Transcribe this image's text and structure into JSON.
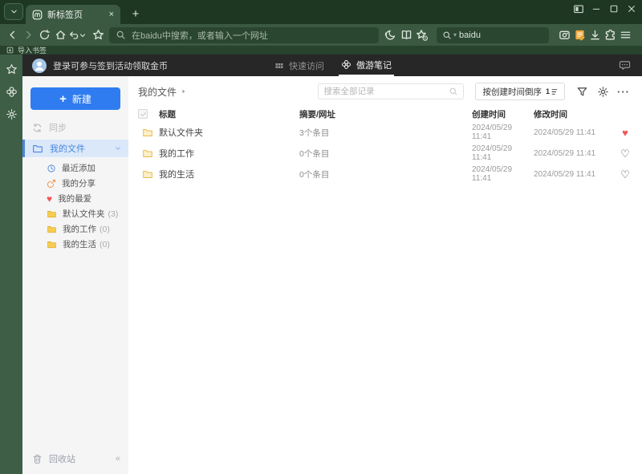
{
  "browser": {
    "tab_title": "新标签页",
    "address_placeholder": "在baidu中搜索，或者输入一个网址",
    "search_value": "baidu",
    "import_bookmarks": "导入书签"
  },
  "app_header": {
    "login_text": "登录可参与签到活动领取金币",
    "tabs": [
      {
        "label": "快速访问",
        "active": false
      },
      {
        "label": "傲游笔记",
        "active": true
      }
    ]
  },
  "notes_sidebar": {
    "new_button": "新建",
    "sync": "同步",
    "my_files": "我的文件",
    "items": [
      {
        "label": "最近添加"
      },
      {
        "label": "我的分享"
      },
      {
        "label": "我的最爱"
      },
      {
        "label": "默认文件夹",
        "count": "(3)"
      },
      {
        "label": "我的工作",
        "count": "(0)"
      },
      {
        "label": "我的生活",
        "count": "(0)"
      }
    ],
    "recycle_bin": "回收站"
  },
  "main": {
    "breadcrumb": "我的文件",
    "search_placeholder": "搜索全部记录",
    "sort_button": "按创建时间倒序",
    "table": {
      "headers": {
        "title": "标题",
        "summary": "摘要/网址",
        "created": "创建时间",
        "modified": "修改时间"
      },
      "rows": [
        {
          "title": "默认文件夹",
          "summary": "3个条目",
          "created": "2024/05/29 11:41",
          "modified": "2024/05/29 11:41",
          "favorite": true
        },
        {
          "title": "我的工作",
          "summary": "0个条目",
          "created": "2024/05/29 11:41",
          "modified": "2024/05/29 11:41",
          "favorite": false
        },
        {
          "title": "我的生活",
          "summary": "0个条目",
          "created": "2024/05/29 11:41",
          "modified": "2024/05/29 11:41",
          "favorite": false
        }
      ]
    }
  },
  "icons": {
    "plus": "+",
    "new_tab_plus": "+",
    "close_x": "×",
    "heart_filled": "♥",
    "heart_outline": "♡",
    "more_dots": "···",
    "collapse": "«",
    "sort_numeral": "1",
    "search_caret": "▾"
  },
  "colors": {
    "tab_bar_bg": "#1d3723",
    "toolbar_bg": "#3b5941",
    "address_bar_bg": "#2a4631",
    "app_header_bg": "#272727",
    "sidebar_bg": "#f5f5f6",
    "accent_blue": "#2f7cf0",
    "selected_item_bg": "#dbe8fa",
    "folder_yellow": "#f6cd51",
    "heart_red": "#f25555"
  }
}
